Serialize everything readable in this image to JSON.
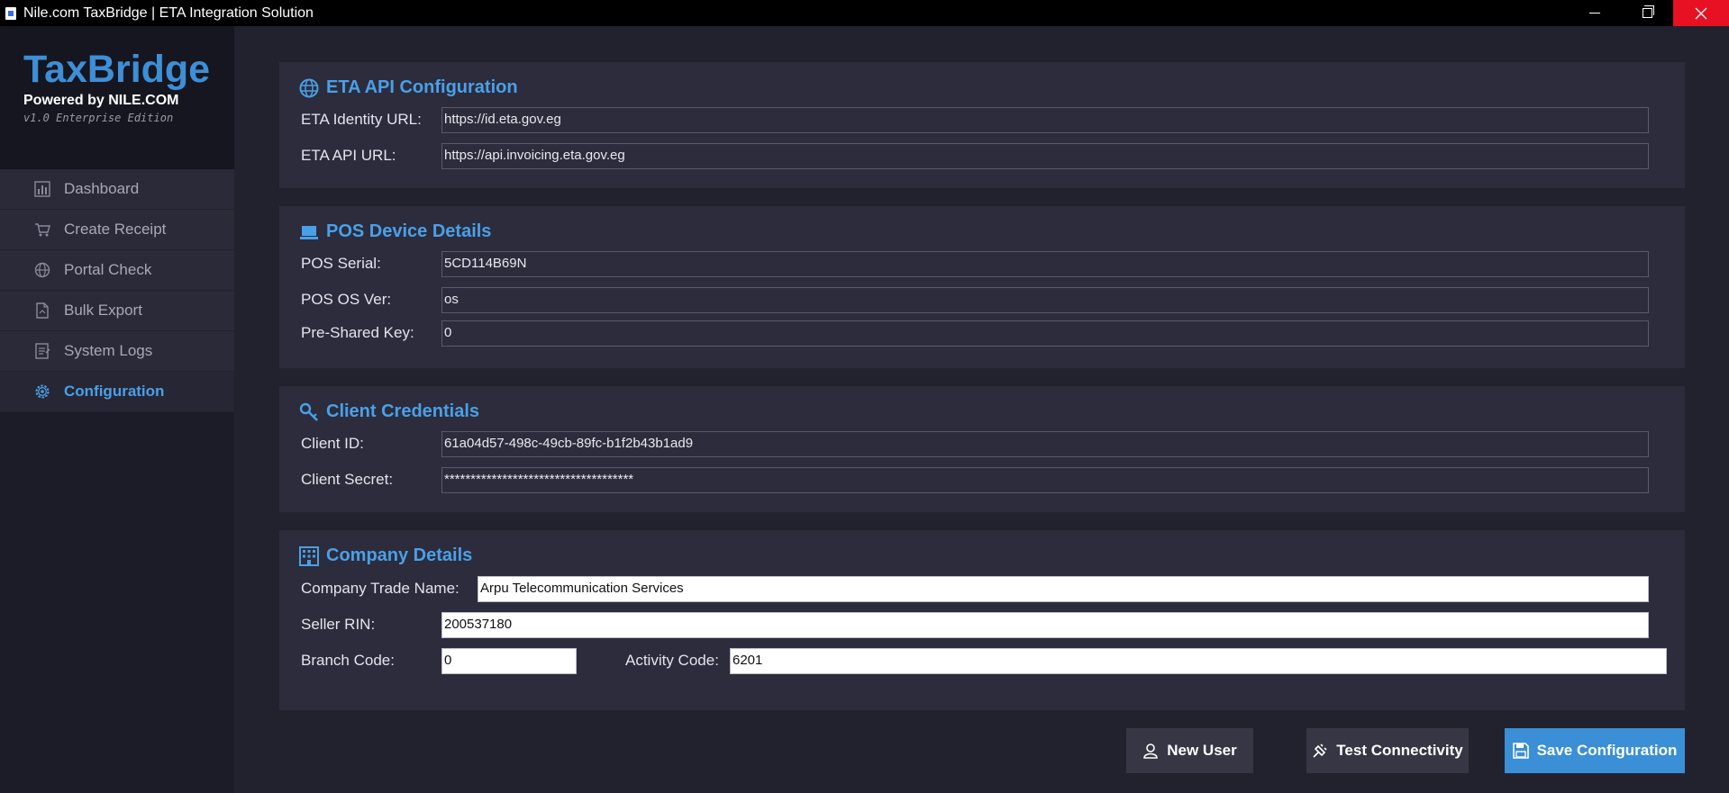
{
  "window": {
    "title": "Nile.com TaxBridge | ETA Integration Solution"
  },
  "brand": {
    "name": "TaxBridge",
    "powered_by": "Powered by NILE.COM",
    "version": "v1.0 Enterprise Edition"
  },
  "nav": {
    "items": [
      {
        "label": "Dashboard",
        "icon": "bar-chart-icon",
        "active": false
      },
      {
        "label": "Create Receipt",
        "icon": "cart-icon",
        "active": false
      },
      {
        "label": "Portal Check",
        "icon": "globe-icon",
        "active": false
      },
      {
        "label": "Bulk Export",
        "icon": "document-icon",
        "active": false
      },
      {
        "label": "System Logs",
        "icon": "logs-icon",
        "active": false
      },
      {
        "label": "Configuration",
        "icon": "gear-icon",
        "active": true
      }
    ]
  },
  "eta_api": {
    "title": "ETA API Configuration",
    "identity_url_label": "ETA Identity URL:",
    "identity_url_value": "https://id.eta.gov.eg",
    "api_url_label": "ETA API URL:",
    "api_url_value": "https://api.invoicing.eta.gov.eg"
  },
  "pos_device": {
    "title": "POS Device Details",
    "serial_label": "POS Serial:",
    "serial_value": "5CD114B69N",
    "os_label": "POS OS Ver:",
    "os_value": "os",
    "psk_label": "Pre-Shared Key:",
    "psk_value": "0"
  },
  "client_credentials": {
    "title": "Client Credentials",
    "client_id_label": "Client ID:",
    "client_id_value": "61a04d57-498c-49cb-89fc-b1f2b43b1ad9",
    "client_secret_label": "Client Secret:",
    "client_secret_value": "************************************"
  },
  "company": {
    "title": "Company Details",
    "trade_name_label": "Company Trade Name:",
    "trade_name_value": "Arpu Telecommunication Services",
    "seller_rin_label": "Seller RIN:",
    "seller_rin_value": "200537180",
    "branch_code_label": "Branch Code:",
    "branch_code_value": "0",
    "activity_code_label": "Activity Code:",
    "activity_code_value": "6201"
  },
  "actions": {
    "new_user": "New User",
    "test_connectivity": "Test Connectivity",
    "save_configuration": "Save Configuration"
  },
  "colors": {
    "accent": "#3a8fd6",
    "background": "#22222f",
    "panel": "#2c2c3c",
    "close": "#e81123"
  }
}
